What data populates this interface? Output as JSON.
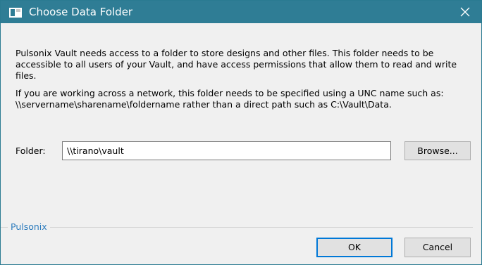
{
  "window": {
    "title": "Choose Data Folder"
  },
  "message": {
    "paragraph1": "Pulsonix Vault needs access to a folder to store designs and other files. This folder needs to be accessible to all users of your Vault, and have access permissions that allow them to read and write files.",
    "paragraph2": "If you are working across a network, this folder needs to be specified using a UNC name such as: \\\\servername\\sharename\\foldername rather than a direct path such as C:\\Vault\\Data."
  },
  "folder": {
    "label": "Folder:",
    "value": "\\\\tirano\\vault",
    "browse_label": "Browse..."
  },
  "footer": {
    "group_label": "Pulsonix",
    "ok_label": "OK",
    "cancel_label": "Cancel"
  },
  "colors": {
    "titlebar": "#2f7d95",
    "link_label": "#2b7bbd",
    "default_button_border": "#0078d7"
  }
}
